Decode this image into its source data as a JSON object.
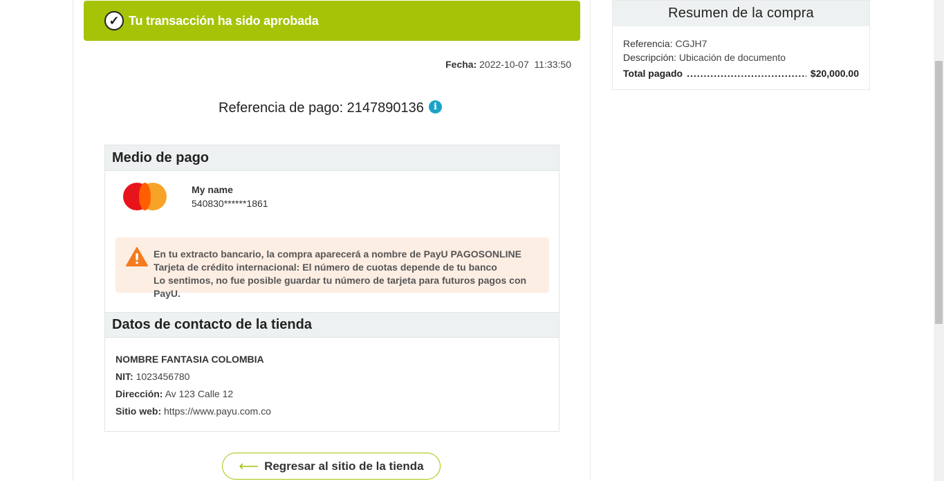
{
  "banner": {
    "message": "Tu transacción ha sido aprobada",
    "check_glyph": "✓",
    "color": "#a6c307"
  },
  "date": {
    "label": "Fecha:",
    "value": "2022-10-07  11:33:50"
  },
  "payment_reference": {
    "label": "Referencia de pago: 2147890136",
    "info_glyph": "i"
  },
  "payment_method": {
    "title": "Medio de pago",
    "card_brand_icon": "mastercard-icon",
    "holder": "My name",
    "card_number": "540830******1861",
    "notice_lines": [
      "En tu extracto bancario, la compra aparecerá a nombre de PayU PAGOSONLINE",
      "Tarjeta de crédito internacional: El número de cuotas depende de tu banco",
      "Lo sentimos, no fue posible guardar tu número de tarjeta para futuros pagos con PayU."
    ]
  },
  "store_contact": {
    "title": "Datos de contacto de la tienda",
    "name": "NOMBRE FANTASIA COLOMBIA",
    "nit_label": "NIT:",
    "nit_value": "1023456780",
    "address_label": "Dirección:",
    "address_value": "Av 123 Calle 12",
    "website_label": "Sitio web:",
    "website_value": "https://www.payu.com.co"
  },
  "back_button": {
    "label": "Regresar al sitio de la tienda",
    "arrow": "⟵"
  },
  "summary": {
    "title": "Resumen de la compra",
    "reference_label": "Referencia:",
    "reference_value": "CGJH7",
    "description_label": "Descripción:",
    "description_value": "Ubicación de documento",
    "total_label": "Total pagado",
    "total_dots": "..........................................",
    "total_value": "$20,000.00"
  }
}
